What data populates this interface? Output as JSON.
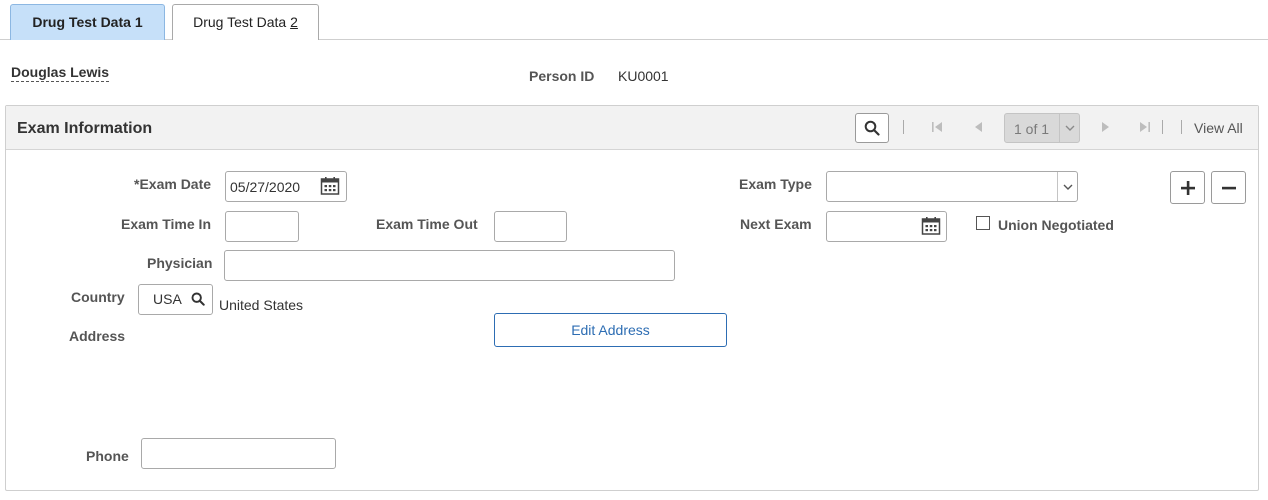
{
  "tabs": [
    {
      "label": "Drug Test Data ",
      "accesskey": "1",
      "active": true
    },
    {
      "label": "Drug Test Data ",
      "accesskey": "2",
      "active": false
    }
  ],
  "header": {
    "person_name": "Douglas Lewis",
    "person_id_label": "Person ID",
    "person_id_value": "KU0001"
  },
  "exam_info": {
    "title": "Exam Information",
    "pager": {
      "text": "1 of 1",
      "view_all": "View All"
    },
    "exam_date_label": "*Exam Date",
    "exam_date_value": "05/27/2020",
    "exam_type_label": "Exam Type",
    "exam_type_value": "",
    "exam_time_in_label": "Exam Time In",
    "exam_time_in_value": "",
    "exam_time_out_label": "Exam Time Out",
    "exam_time_out_value": "",
    "next_exam_label": "Next Exam",
    "next_exam_value": "",
    "union_negotiated_label": "Union Negotiated",
    "union_negotiated_checked": false,
    "physician_label": "Physician",
    "physician_value": "",
    "country_label": "Country",
    "country_code": "USA",
    "country_name": "United States",
    "address_label": "Address",
    "edit_address_label": "Edit Address",
    "phone_label": "Phone",
    "phone_value": ""
  },
  "icons": [
    "search-icon",
    "first-page-icon",
    "previous-page-icon",
    "next-page-icon",
    "last-page-icon",
    "chevron-down-icon",
    "calendar-icon",
    "plus-icon",
    "minus-icon",
    "lookup-icon"
  ],
  "colors": {
    "active_tab": "#c6e0f9",
    "link_blue": "#2d6db3",
    "header_bg": "#f2f2f2"
  }
}
